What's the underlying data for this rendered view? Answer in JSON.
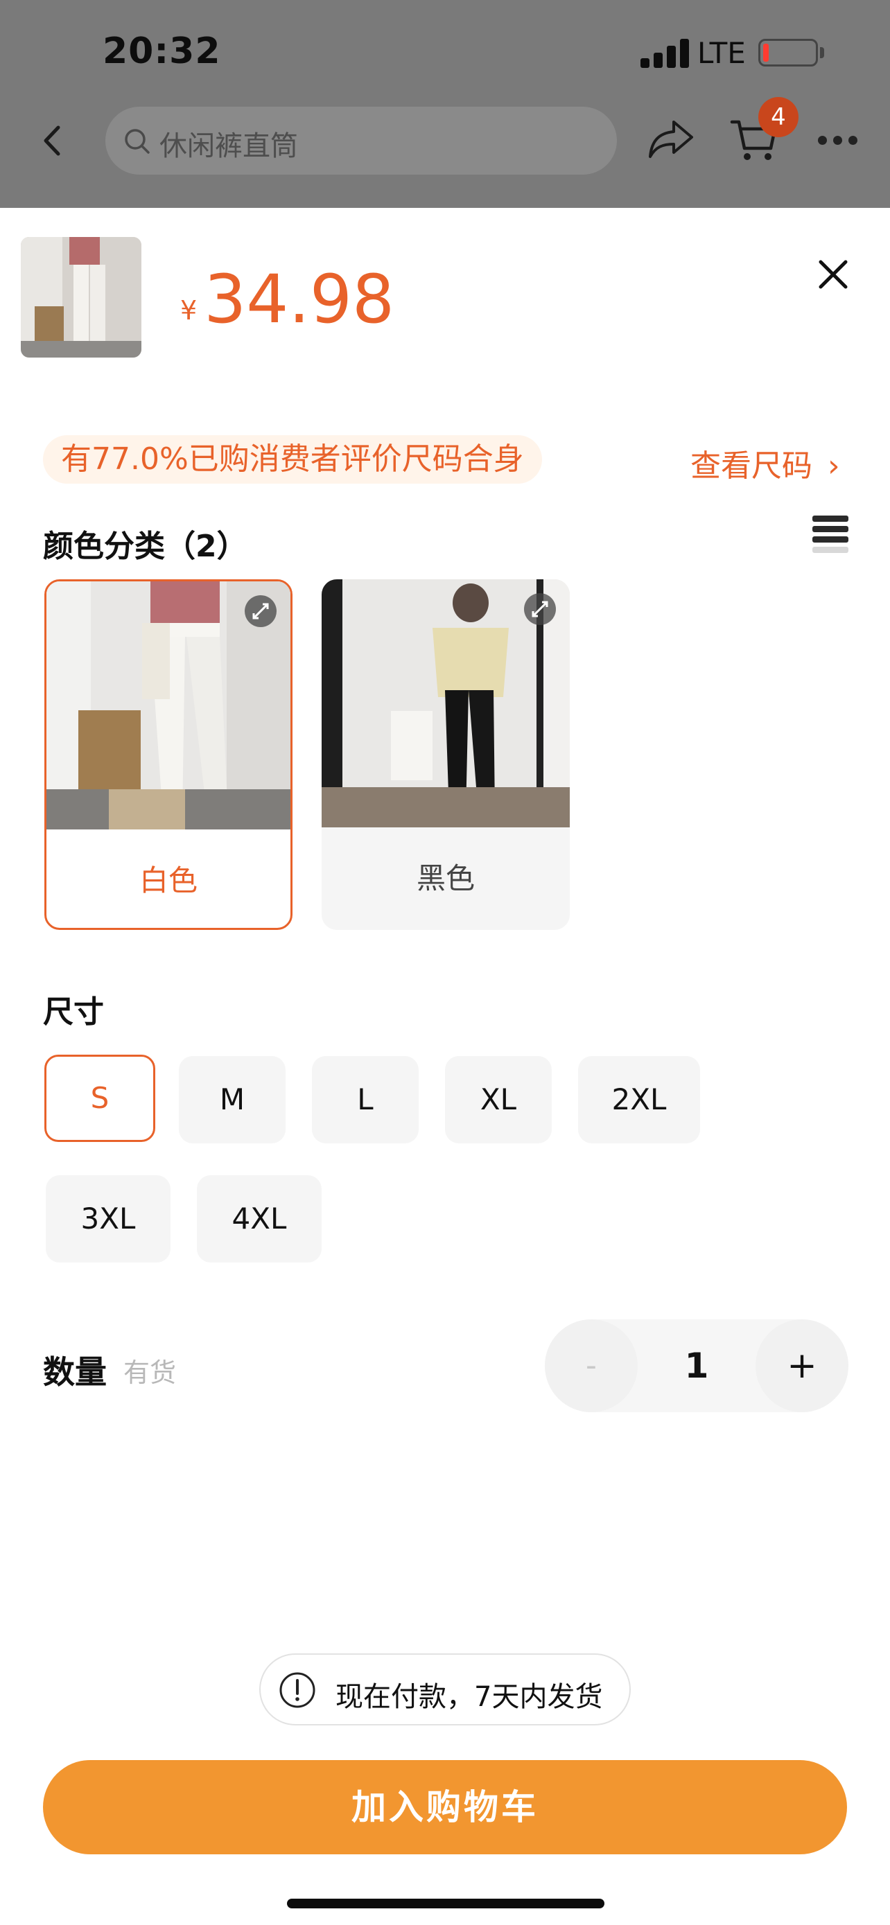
{
  "status_bar": {
    "time": "20:32",
    "network": "LTE"
  },
  "top_nav": {
    "search_placeholder": "休闲裤直筒",
    "cart_count": "4"
  },
  "product": {
    "currency": "¥",
    "price": "34.98"
  },
  "fit": {
    "message": "有77.0%已购消费者评价尺码合身",
    "size_link": "查看尺码",
    "size_link_chevron": "›"
  },
  "color_section": {
    "title": "颜色分类（2）",
    "options": [
      {
        "label": "白色",
        "selected": true
      },
      {
        "label": "黑色",
        "selected": false
      }
    ]
  },
  "size_section": {
    "title": "尺寸",
    "options": [
      {
        "label": "S",
        "selected": true
      },
      {
        "label": "M",
        "selected": false
      },
      {
        "label": "L",
        "selected": false
      },
      {
        "label": "XL",
        "selected": false
      },
      {
        "label": "2XL",
        "selected": false
      },
      {
        "label": "3XL",
        "selected": false
      },
      {
        "label": "4XL",
        "selected": false
      }
    ]
  },
  "quantity": {
    "label": "数量",
    "stock": "有货",
    "minus": "-",
    "value": "1",
    "plus": "+"
  },
  "shipping_notice": "现在付款，7天内发货",
  "cta": {
    "add_to_cart": "加入购物车"
  },
  "colors": {
    "accent": "#e8622a",
    "cta": "#f29630",
    "badge": "#c9461c",
    "overlay": "#7a7a7a"
  },
  "icons": [
    "back-icon",
    "search-icon",
    "share-icon",
    "cart-icon",
    "more-icon",
    "close-icon",
    "chevron-right-icon",
    "list-view-icon",
    "expand-icon",
    "warning-icon"
  ]
}
